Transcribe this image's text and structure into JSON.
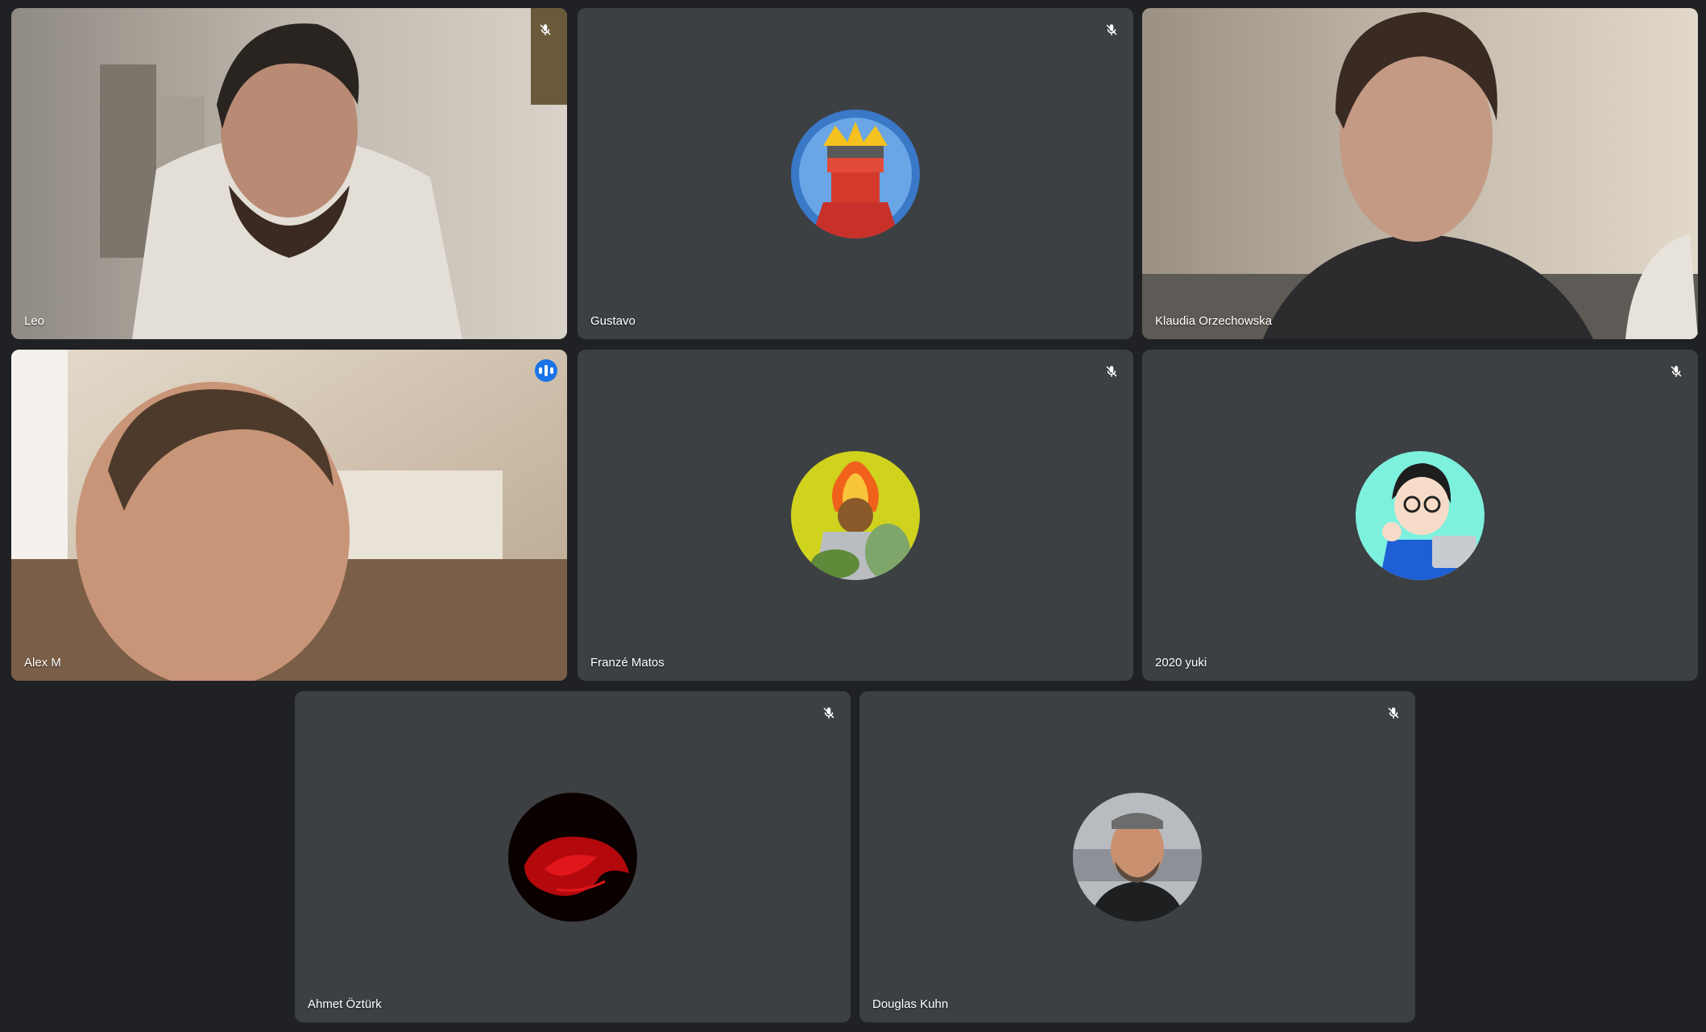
{
  "participants": [
    {
      "name": "Leo",
      "muted": true,
      "camera_on": true
    },
    {
      "name": "Gustavo",
      "muted": true,
      "camera_on": false
    },
    {
      "name": "Klaudia Orzechowska",
      "muted": false,
      "camera_on": true
    },
    {
      "name": "Alex M",
      "muted": false,
      "speaking": true,
      "camera_on": true
    },
    {
      "name": "Franzé Matos",
      "muted": true,
      "camera_on": false
    },
    {
      "name": "2020 yuki",
      "muted": true,
      "camera_on": false
    },
    {
      "name": "Ahmet Öztürk",
      "muted": true,
      "camera_on": false
    },
    {
      "name": "Douglas Kuhn",
      "muted": true,
      "camera_on": false
    }
  ],
  "icons": {
    "mute": "mic-off-icon",
    "speaking": "audio-level-icon"
  },
  "colors": {
    "background": "#202124",
    "tile": "#3c4043",
    "active_speaker_border": "#8ab4f8",
    "speaking_badge": "#1a73e8"
  }
}
